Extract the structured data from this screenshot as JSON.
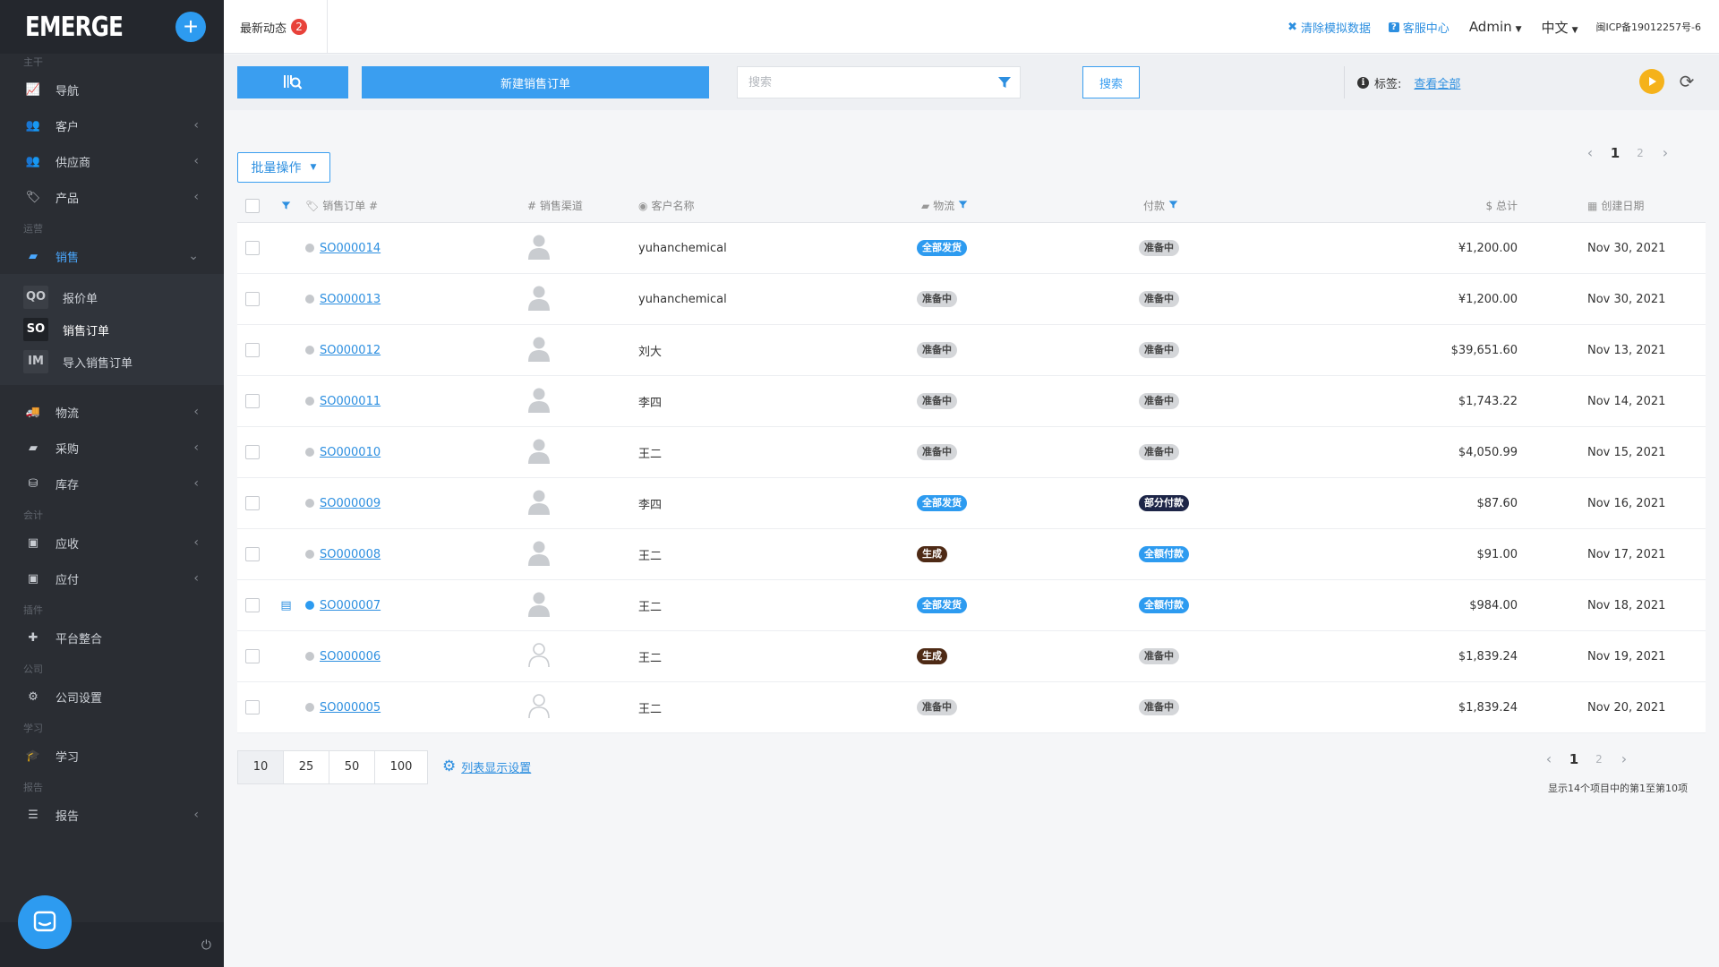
{
  "sidebar": {
    "logo": "EMERGE",
    "add_label": "+",
    "sections": {
      "main": "主干",
      "ops": "运营",
      "accounting": "会计",
      "plugins": "插件",
      "company": "公司",
      "learn": "学习",
      "reports": "报告"
    },
    "items": {
      "nav": "导航",
      "customers": "客户",
      "suppliers": "供应商",
      "products": "产品",
      "sales": "销售",
      "logistics": "物流",
      "purchase": "采购",
      "inventory": "库存",
      "receivable": "应收",
      "payable": "应付",
      "platform": "平台整合",
      "company_settings": "公司设置",
      "learning": "学习",
      "reports": "报告"
    },
    "sales_sub": [
      {
        "abbr": "QO",
        "label": "报价单"
      },
      {
        "abbr": "SO",
        "label": "销售订单"
      },
      {
        "abbr": "IM",
        "label": "导入销售订单"
      }
    ]
  },
  "topbar": {
    "news_label": "最新动态",
    "news_count": "2",
    "clear_data": "清除模拟数据",
    "support": "客服中心",
    "user": "Admin",
    "language": "中文",
    "icp": "闽ICP备19012257号-6"
  },
  "toolbar": {
    "new_order": "新建销售订单",
    "search_placeholder": "搜索",
    "search_button": "搜索",
    "tags_label": "标签:",
    "tags_link": "查看全部"
  },
  "main": {
    "batch_label": "批量操作",
    "pager": {
      "current": "1",
      "next": "2"
    },
    "columns": {
      "order": "销售订单 #",
      "channel": "# 销售渠道",
      "customer": "客户名称",
      "logistics": "物流",
      "payment": "付款",
      "total": "$ 总计",
      "date": "创建日期"
    },
    "rows": [
      {
        "order": "SO000014",
        "customer": "yuhanchemical",
        "logistics": "全部发货",
        "payment": "准备中",
        "total": "¥1,200.00",
        "date": "Nov 30, 2021"
      },
      {
        "order": "SO000013",
        "customer": "yuhanchemical",
        "logistics": "准备中",
        "payment": "准备中",
        "total": "¥1,200.00",
        "date": "Nov 30, 2021"
      },
      {
        "order": "SO000012",
        "customer": "刘大",
        "logistics": "准备中",
        "payment": "准备中",
        "total": "$39,651.60",
        "date": "Nov 13, 2021"
      },
      {
        "order": "SO000011",
        "customer": "李四",
        "logistics": "准备中",
        "payment": "准备中",
        "total": "$1,743.22",
        "date": "Nov 14, 2021"
      },
      {
        "order": "SO000010",
        "customer": "王二",
        "logistics": "准备中",
        "payment": "准备中",
        "total": "$4,050.99",
        "date": "Nov 15, 2021"
      },
      {
        "order": "SO000009",
        "customer": "李四",
        "logistics": "全部发货",
        "payment": "部分付款",
        "total": "$87.60",
        "date": "Nov 16, 2021"
      },
      {
        "order": "SO000008",
        "customer": "王二",
        "logistics": "生成",
        "payment": "全额付款",
        "total": "$91.00",
        "date": "Nov 17, 2021"
      },
      {
        "order": "SO000007",
        "customer": "王二",
        "logistics": "全部发货",
        "payment": "全额付款",
        "total": "$984.00",
        "date": "Nov 18, 2021"
      },
      {
        "order": "SO000006",
        "customer": "王二",
        "logistics": "生成",
        "payment": "准备中",
        "total": "$1,839.24",
        "date": "Nov 19, 2021"
      },
      {
        "order": "SO000005",
        "customer": "王二",
        "logistics": "准备中",
        "payment": "准备中",
        "total": "$1,839.24",
        "date": "Nov 20, 2021"
      }
    ],
    "page_sizes": [
      "10",
      "25",
      "50",
      "100"
    ],
    "list_settings": "列表显示设置",
    "summary": "显示14个项目中的第1至第10项"
  },
  "colors": {
    "accent": "#3a9ef0",
    "sidebar_bg": "#2a2d33",
    "badge_brown": "#4e2a15",
    "badge_navy": "#1d2547",
    "play": "#f5b21b"
  }
}
